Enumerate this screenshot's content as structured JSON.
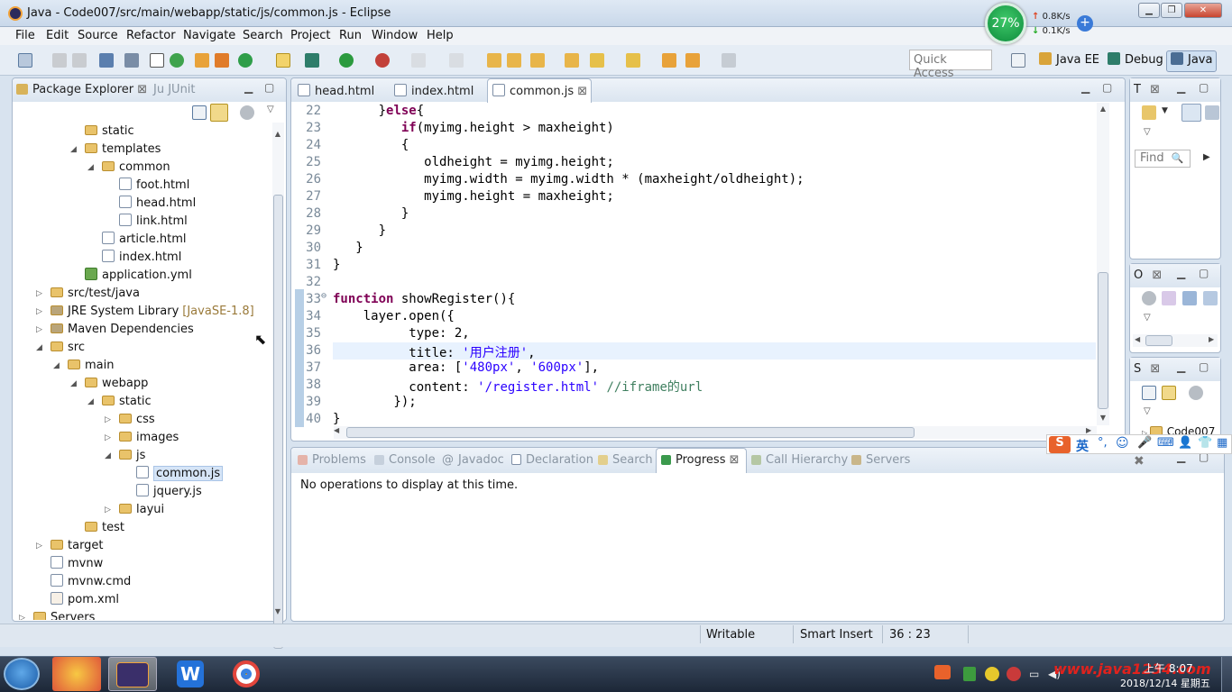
{
  "window": {
    "title": "Java - Code007/src/main/webapp/static/js/common.js - Eclipse",
    "minimize": "▁",
    "restore": "❐",
    "close": "✕"
  },
  "net_widget": {
    "percent": "27%",
    "up": "0.8K/s",
    "down": "0.1K/s",
    "plus": "+"
  },
  "menu": [
    "File",
    "Edit",
    "Source",
    "Refactor",
    "Navigate",
    "Search",
    "Project",
    "Run",
    "Window",
    "Help"
  ],
  "toolbar": {
    "quick_access_placeholder": "Quick Access"
  },
  "perspectives": {
    "java_ee": "Java EE",
    "debug": "Debug",
    "java": "Java"
  },
  "package_explorer": {
    "tab_label": "Package Explorer",
    "junit_tab": "JUnit",
    "items": [
      {
        "label": "static",
        "kind": "folder",
        "depth": 4,
        "arrow": ""
      },
      {
        "label": "templates",
        "kind": "folder",
        "depth": 4,
        "arrow": "◢"
      },
      {
        "label": "common",
        "kind": "folder",
        "depth": 5,
        "arrow": "◢"
      },
      {
        "label": "foot.html",
        "kind": "file",
        "depth": 6,
        "arrow": ""
      },
      {
        "label": "head.html",
        "kind": "file",
        "depth": 6,
        "arrow": ""
      },
      {
        "label": "link.html",
        "kind": "file",
        "depth": 6,
        "arrow": ""
      },
      {
        "label": "article.html",
        "kind": "file",
        "depth": 5,
        "arrow": ""
      },
      {
        "label": "index.html",
        "kind": "file",
        "depth": 5,
        "arrow": ""
      },
      {
        "label": "application.yml",
        "kind": "yml",
        "depth": 4,
        "arrow": ""
      },
      {
        "label": "src/test/java",
        "kind": "pkg",
        "depth": 2,
        "arrow": "▷"
      },
      {
        "label": "JRE System Library",
        "extra": "[JavaSE-1.8]",
        "kind": "lib",
        "depth": 2,
        "arrow": "▷"
      },
      {
        "label": "Maven Dependencies",
        "kind": "lib",
        "depth": 2,
        "arrow": "▷"
      },
      {
        "label": "src",
        "kind": "folder",
        "depth": 2,
        "arrow": "◢"
      },
      {
        "label": "main",
        "kind": "folder",
        "depth": 3,
        "arrow": "◢"
      },
      {
        "label": "webapp",
        "kind": "folder",
        "depth": 4,
        "arrow": "◢"
      },
      {
        "label": "static",
        "kind": "folder",
        "depth": 5,
        "arrow": "◢"
      },
      {
        "label": "css",
        "kind": "folder",
        "depth": 6,
        "arrow": "▷"
      },
      {
        "label": "images",
        "kind": "folder",
        "depth": 6,
        "arrow": "▷"
      },
      {
        "label": "js",
        "kind": "folder",
        "depth": 6,
        "arrow": "◢"
      },
      {
        "label": "common.js",
        "kind": "js",
        "depth": 7,
        "arrow": "",
        "selected": true
      },
      {
        "label": "jquery.js",
        "kind": "js",
        "depth": 7,
        "arrow": ""
      },
      {
        "label": "layui",
        "kind": "folder",
        "depth": 6,
        "arrow": "▷"
      },
      {
        "label": "test",
        "kind": "folder",
        "depth": 4,
        "arrow": ""
      },
      {
        "label": "target",
        "kind": "folder",
        "depth": 2,
        "arrow": "▷"
      },
      {
        "label": "mvnw",
        "kind": "file",
        "depth": 2,
        "arrow": ""
      },
      {
        "label": "mvnw.cmd",
        "kind": "file",
        "depth": 2,
        "arrow": ""
      },
      {
        "label": "pom.xml",
        "kind": "xml",
        "depth": 2,
        "arrow": ""
      },
      {
        "label": "Servers",
        "kind": "folder",
        "depth": 1,
        "arrow": "▷"
      }
    ]
  },
  "editor": {
    "tabs": [
      {
        "label": "head.html",
        "active": false
      },
      {
        "label": "index.html",
        "active": false
      },
      {
        "label": "common.js",
        "active": true
      }
    ],
    "lines": [
      {
        "n": "22",
        "html": "      }<span class=\"kw\">else</span>{"
      },
      {
        "n": "23",
        "html": "         <span class=\"kw\">if</span>(myimg.height > maxheight)"
      },
      {
        "n": "24",
        "html": "         {"
      },
      {
        "n": "25",
        "html": "            oldheight = myimg.height;"
      },
      {
        "n": "26",
        "html": "            myimg.width = myimg.width * (maxheight/oldheight);"
      },
      {
        "n": "27",
        "html": "            myimg.height = maxheight;"
      },
      {
        "n": "28",
        "html": "         }"
      },
      {
        "n": "29",
        "html": "      }"
      },
      {
        "n": "30",
        "html": "   }"
      },
      {
        "n": "31",
        "html": "}"
      },
      {
        "n": "32",
        "html": ""
      },
      {
        "n": "33",
        "html": "<span class=\"kw\">function</span> showRegister(){",
        "fold": "⊖"
      },
      {
        "n": "34",
        "html": "    layer.open({"
      },
      {
        "n": "35",
        "html": "          type: 2,"
      },
      {
        "n": "36",
        "html": "          title: <span class=\"str\">'用户注册'</span>,",
        "current": true
      },
      {
        "n": "37",
        "html": "          area: [<span class=\"str\">'480px'</span>, <span class=\"str\">'600px'</span>],"
      },
      {
        "n": "38",
        "html": "          content: <span class=\"str\">'/register.html'</span> <span class=\"cm\">//iframe的url</span>"
      },
      {
        "n": "39",
        "html": "        });"
      },
      {
        "n": "40",
        "html": "}"
      }
    ]
  },
  "bottom_panel": {
    "tabs": [
      "Problems",
      "Console",
      "Javadoc",
      "Declaration",
      "Search",
      "Progress",
      "Call Hierarchy",
      "Servers"
    ],
    "active_tab": "Progress",
    "message": "No operations to display at this time."
  },
  "right_views": {
    "outline_letter": "T",
    "find_placeholder": "Find",
    "view_o_letter": "O",
    "view_s_letter": "S",
    "tree_item": "Code007"
  },
  "status": {
    "writable": "Writable",
    "insert_mode": "Smart Insert",
    "position": "36 : 23"
  },
  "ime": {
    "label": "英"
  },
  "clock": {
    "time": "上午 8:07",
    "date": "2018/12/14 星期五",
    "watermark": "www.java1234.com"
  }
}
